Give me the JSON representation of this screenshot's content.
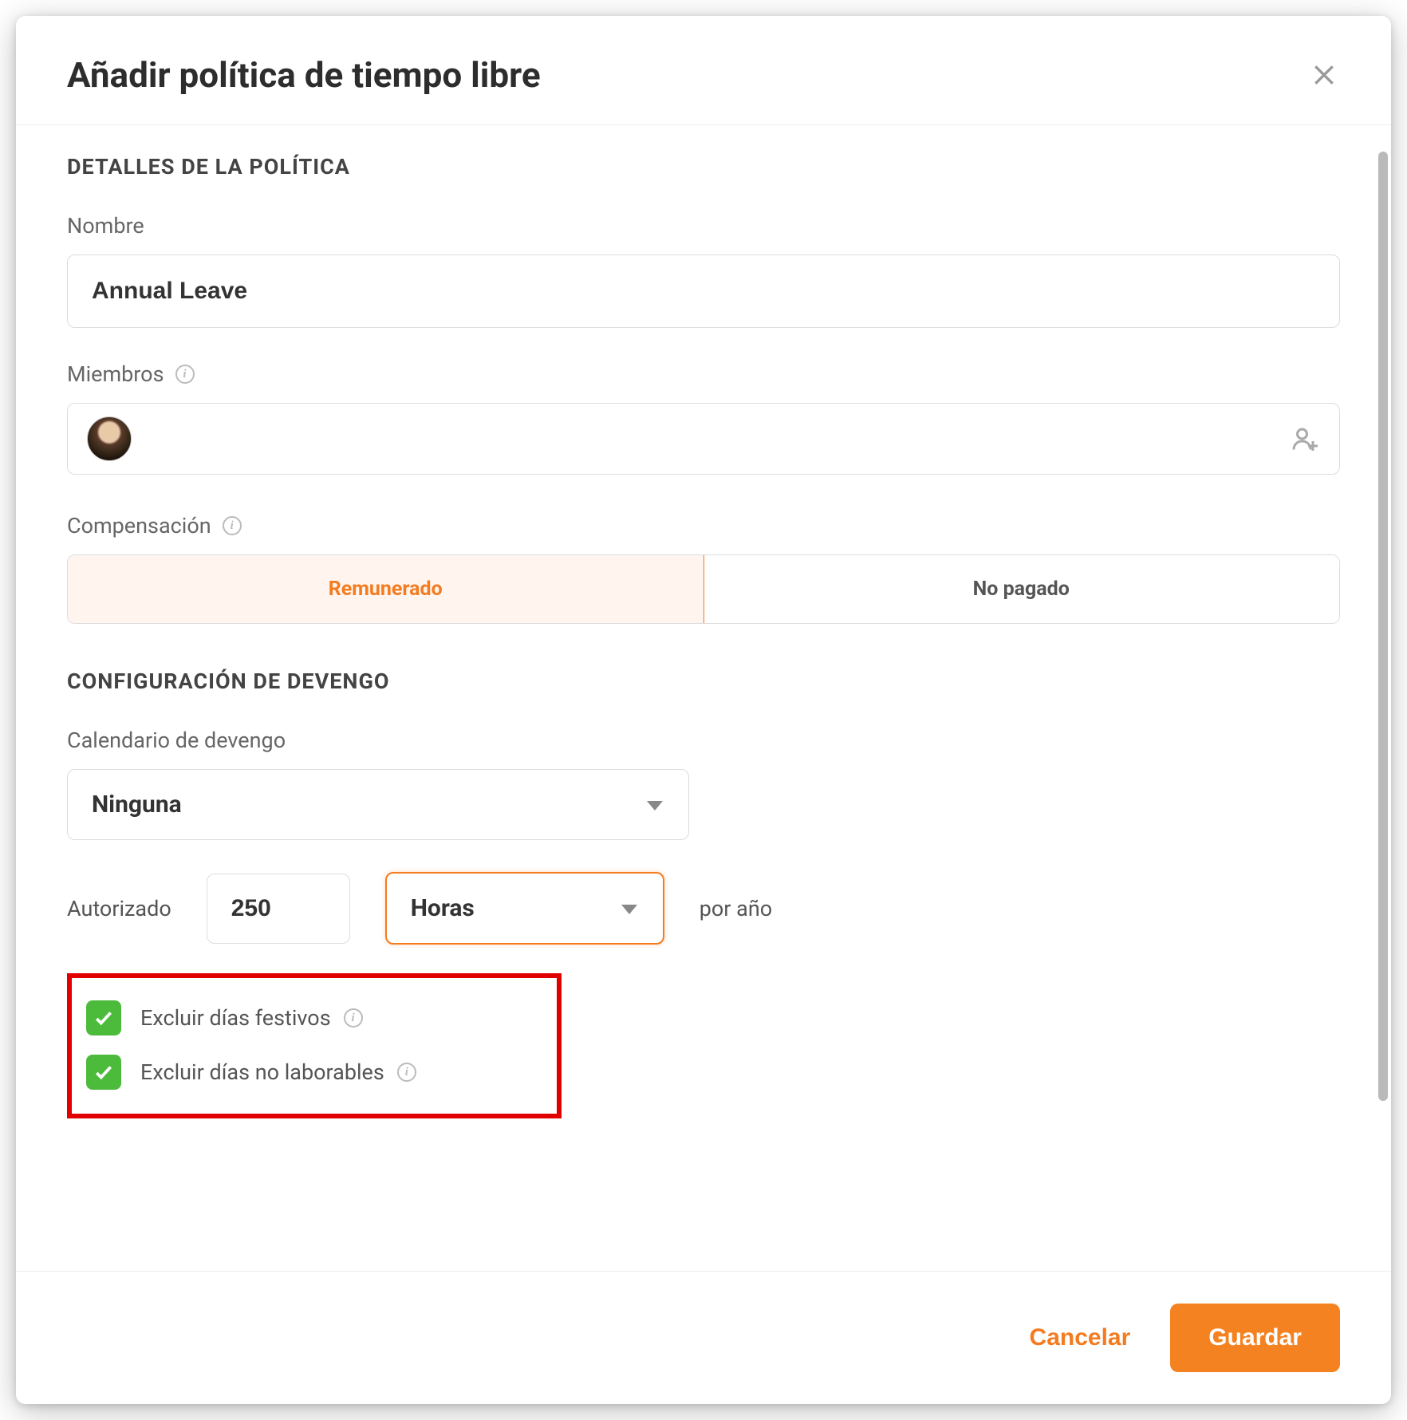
{
  "modal": {
    "title": "Añadir política de tiempo libre"
  },
  "sections": {
    "policy_details": "DETALLES DE LA POLÍTICA",
    "accrual_config": "CONFIGURACIÓN DE DEVENGO"
  },
  "fields": {
    "name_label": "Nombre",
    "name_value": "Annual Leave",
    "members_label": "Miembros",
    "compensation_label": "Compensación",
    "compensation_options": {
      "paid": "Remunerado",
      "unpaid": "No pagado"
    },
    "schedule_label": "Calendario de devengo",
    "schedule_value": "Ninguna",
    "allowed_label": "Autorizado",
    "allowed_value": "250",
    "units_value": "Horas",
    "per_year_label": "por año",
    "exclude_holidays": "Excluir días festivos",
    "exclude_nonworking": "Excluir días no laborables"
  },
  "footer": {
    "cancel": "Cancelar",
    "save": "Guardar"
  }
}
